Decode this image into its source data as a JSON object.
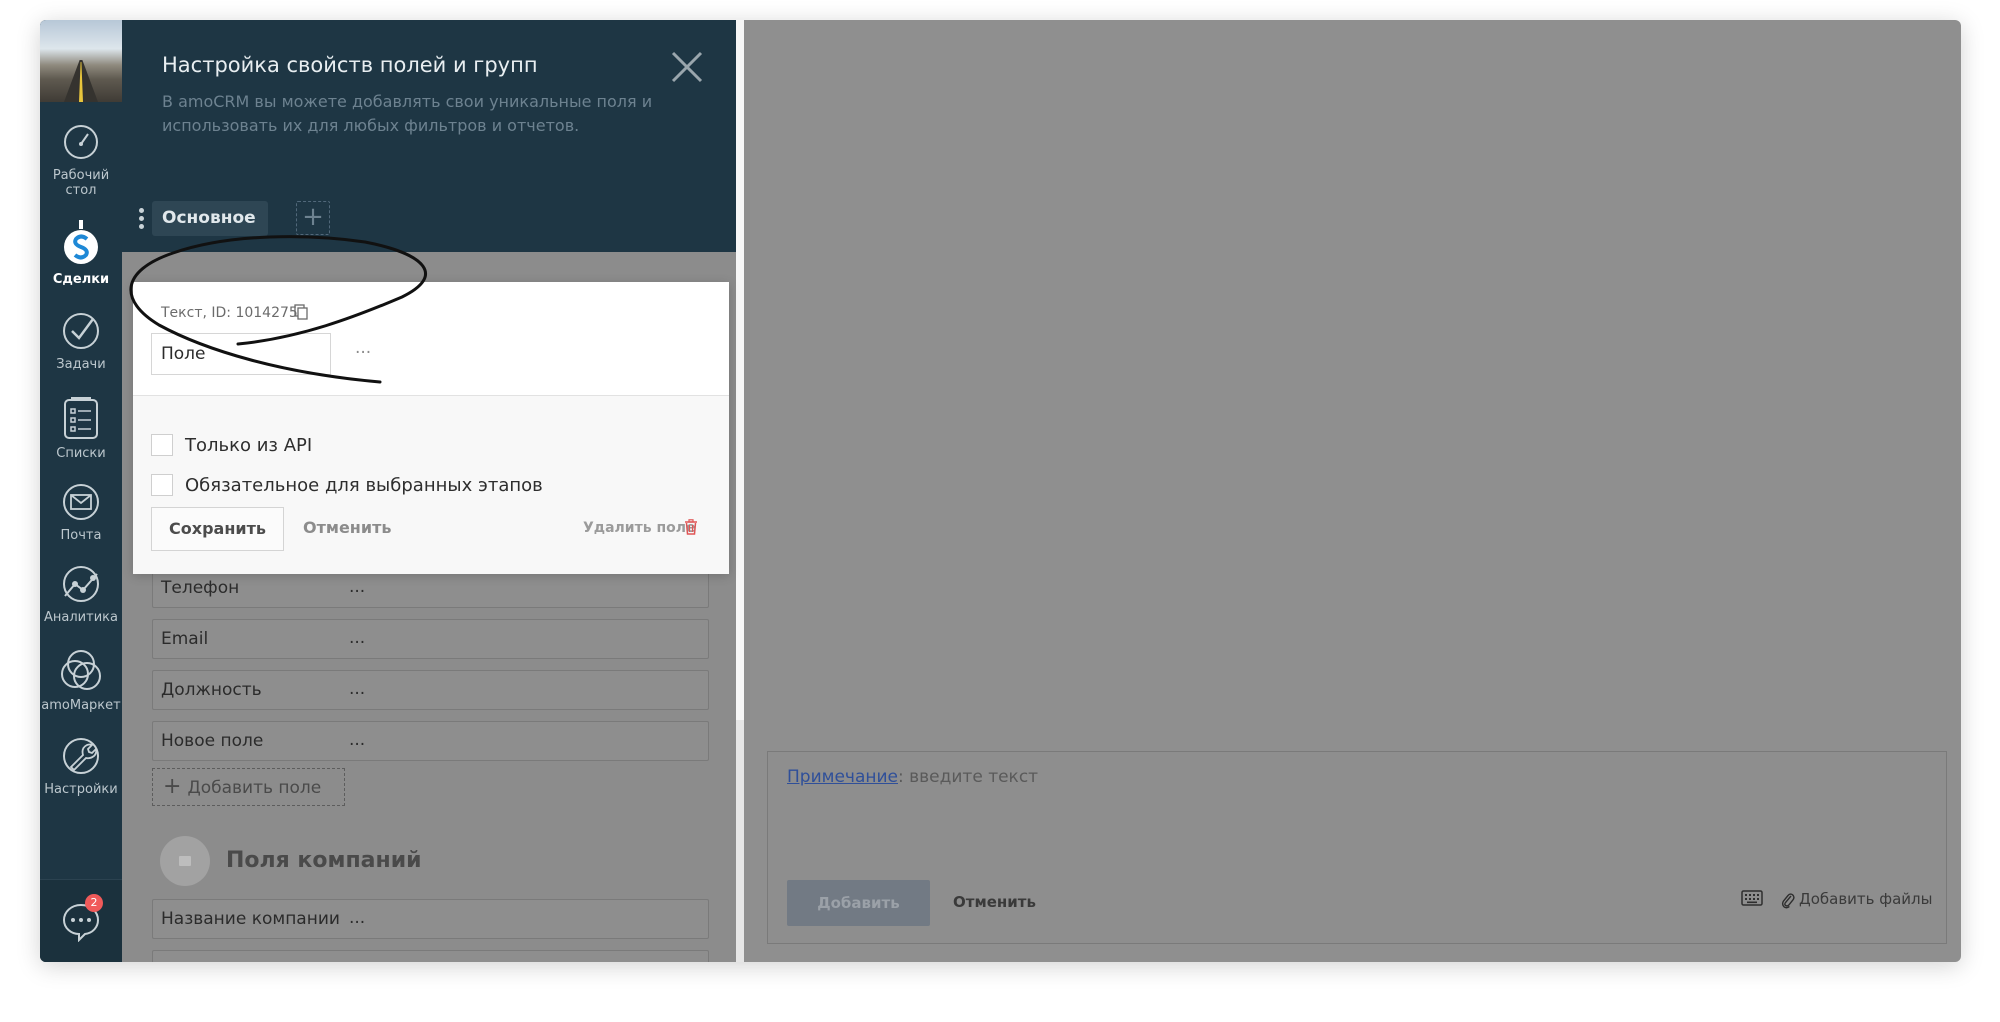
{
  "nav": {
    "items": [
      {
        "label": "Рабочий стол",
        "icon": "dashboard-icon"
      },
      {
        "label": "Сделки",
        "icon": "deals-icon",
        "active": true
      },
      {
        "label": "Задачи",
        "icon": "tasks-icon"
      },
      {
        "label": "Списки",
        "icon": "lists-icon"
      },
      {
        "label": "Почта",
        "icon": "mail-icon"
      },
      {
        "label": "Аналитика",
        "icon": "analytics-icon"
      },
      {
        "label": "amoМаркет",
        "icon": "market-icon"
      },
      {
        "label": "Настройки",
        "icon": "settings-icon"
      }
    ],
    "chat": {
      "icon": "chat-icon",
      "badge": "2"
    }
  },
  "panel": {
    "title": "Настройка свойств полей и групп",
    "description": "В amoCRM вы можете добавлять свои уникальные поля и использовать их для любых фильтров и отчетов.",
    "tabs": [
      {
        "label": "Основное"
      }
    ],
    "add_tab_symbol": "+"
  },
  "popup": {
    "type_id": "Текст, ID: 1014275",
    "field_name": "Поле",
    "more": "...",
    "checkboxes": [
      {
        "label": "Только из API",
        "checked": false
      },
      {
        "label": "Обязательное для выбранных этапов",
        "checked": false
      }
    ],
    "save_label": "Сохранить",
    "cancel_label": "Отменить",
    "delete_label": "Удалить поле"
  },
  "fields": [
    {
      "name": "Телефон",
      "more": "..."
    },
    {
      "name": "Email",
      "more": "..."
    },
    {
      "name": "Должность",
      "more": "..."
    },
    {
      "name": "Новое поле",
      "more": "..."
    }
  ],
  "add_field": {
    "symbol": "+",
    "label": "Добавить поле"
  },
  "company": {
    "header": "Поля компаний",
    "fields": [
      {
        "name": "Название компании",
        "more": "..."
      }
    ]
  },
  "note": {
    "link_label": "Примечание",
    "placeholder": ": введите текст",
    "add_label": "Добавить",
    "cancel_label": "Отменить",
    "attach_label": "Добавить файлы"
  },
  "colors": {
    "sidebar": "#1e3644",
    "overlay": "#8f8f8f",
    "badge": "#f05a5a",
    "link": "#2f4f99"
  }
}
